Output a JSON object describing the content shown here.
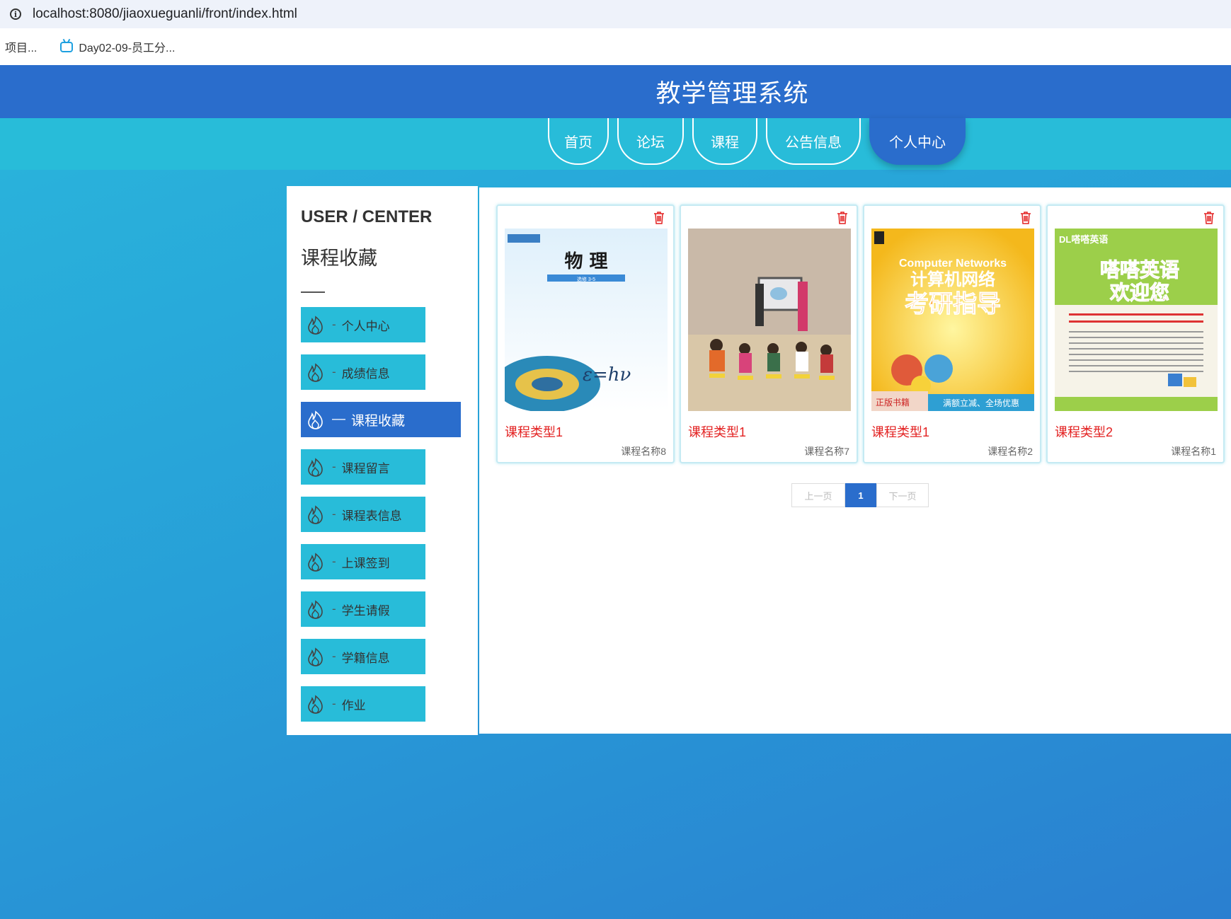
{
  "browser": {
    "url": "localhost:8080/jiaoxueguanli/front/index.html",
    "bookmarks": [
      {
        "label": "项目..."
      },
      {
        "label": "Day02-09-员工分..."
      }
    ]
  },
  "header": {
    "title": "教学管理系统"
  },
  "nav": {
    "items": [
      {
        "label": "首页"
      },
      {
        "label": "论坛"
      },
      {
        "label": "课程"
      },
      {
        "label": "公告信息"
      },
      {
        "label": "个人中心"
      }
    ],
    "active": "个人中心"
  },
  "sidebar": {
    "title_en": "USER / CENTER",
    "title_cn": "课程收藏",
    "items": [
      {
        "label": "个人中心"
      },
      {
        "label": "成绩信息"
      },
      {
        "label": "课程收藏"
      },
      {
        "label": "课程留言"
      },
      {
        "label": "课程表信息"
      },
      {
        "label": "上课签到"
      },
      {
        "label": "学生请假"
      },
      {
        "label": "学籍信息"
      },
      {
        "label": "作业"
      }
    ],
    "active": "课程收藏"
  },
  "cards": [
    {
      "type": "课程类型1",
      "name": "课程名称8",
      "image_text": [
        "物 理",
        "选修 3-5",
        "ε=hν"
      ]
    },
    {
      "type": "课程类型1",
      "name": "课程名称7",
      "image_text": []
    },
    {
      "type": "课程类型1",
      "name": "课程名称2",
      "image_text": [
        "Computer Networks",
        "计算机网络",
        "考研指导",
        "正版书籍",
        "满额立减、全场优惠"
      ]
    },
    {
      "type": "课程类型2",
      "name": "课程名称1",
      "image_text": [
        "DL嗒嗒英语",
        "嗒嗒英语",
        "欢迎您"
      ]
    }
  ],
  "pagination": {
    "prev": "上一页",
    "current": "1",
    "next": "下一页"
  },
  "colors": {
    "primary": "#2a6dcc",
    "accent": "#28bcd9",
    "danger": "#e32222"
  }
}
